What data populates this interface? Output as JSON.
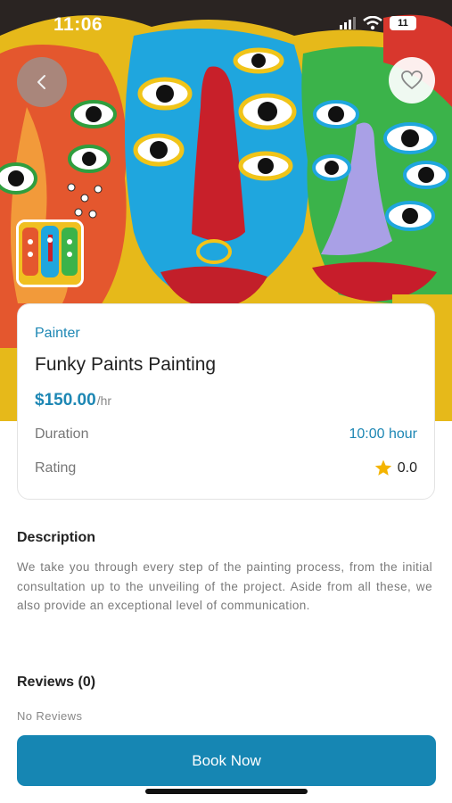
{
  "status_bar": {
    "time": "11:06",
    "battery": "11"
  },
  "icons": {
    "back": "chevron-left-icon",
    "favorite": "heart-icon",
    "signal": "signal-icon",
    "wifi": "wifi-icon",
    "battery": "battery-icon",
    "star": "star-icon"
  },
  "service": {
    "category": "Painter",
    "title": "Funky Paints Painting",
    "price": "$150.00",
    "price_unit": "/hr",
    "duration_label": "Duration",
    "duration_value": "10:00 hour",
    "rating_label": "Rating",
    "rating_value": "0.0"
  },
  "description": {
    "heading": "Description",
    "text": "We take you through every step of the painting process, from the initial consultation up to the unveiling of the project. Aside from all these, we also provide an exceptional level of communication."
  },
  "reviews": {
    "heading": "Reviews (0)",
    "empty_text": "No Reviews"
  },
  "book_button": {
    "label": "Book Now"
  },
  "colors": {
    "accent": "#1d87b4",
    "button": "#1686b3",
    "star": "#f4b400"
  }
}
